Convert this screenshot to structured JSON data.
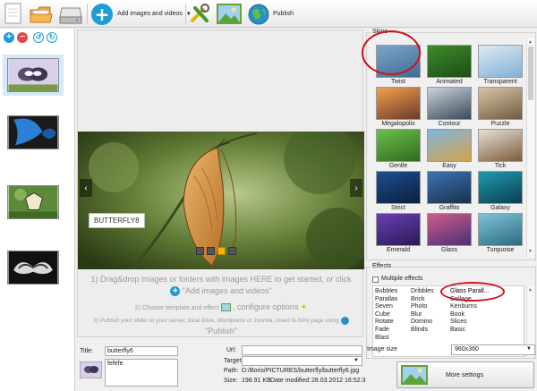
{
  "toolbar": {
    "add_label": "Add images and videos",
    "publish_label": "Publish"
  },
  "slide": {
    "caption": "BUTTERFLY8",
    "bullets": [
      false,
      false,
      true,
      false
    ]
  },
  "hints": {
    "line1": "1) Drag&drop images or folders with images HERE to get started, or click",
    "line1b": "\"Add images and videos\"",
    "line2a": "2) Choose template and effect",
    "line2b": ", configure options",
    "line3": "3) Publish your slider to your server, local drive, Wordpress or Joomla, insert to html page using",
    "line3b": "\"Publish\""
  },
  "props": {
    "title_label": "Title:",
    "title_value": "butterfly6",
    "desc_value": "fefefe",
    "url_label": "Url:",
    "url_value": "",
    "target_label": "Target",
    "path_label": "Path:",
    "path_value": "D:/Boris/PICTURES/butterfly/butterfly6.jpg",
    "size_label": "Size:",
    "size_value": "198.91 KB",
    "date_label": "Date modified:",
    "date_value": "28.03.2012 16:52:31"
  },
  "skins": {
    "title": "Skins",
    "items": [
      {
        "name": "Twist",
        "c1": "#7fa4c9",
        "c2": "#3f6c97"
      },
      {
        "name": "Animated",
        "c1": "#3e8a2c",
        "c2": "#1d4e17"
      },
      {
        "name": "Transparent",
        "c1": "#e0eaf3",
        "c2": "#7fb0d6"
      },
      {
        "name": "Megalopolis",
        "c1": "#f2a04a",
        "c2": "#6a3b2a"
      },
      {
        "name": "Contour",
        "c1": "#c9d4de",
        "c2": "#3a4a56"
      },
      {
        "name": "Puzzle",
        "c1": "#d9c5a5",
        "c2": "#6e5a40"
      },
      {
        "name": "Gentle",
        "c1": "#6cc04a",
        "c2": "#2f6a1c"
      },
      {
        "name": "Easy",
        "c1": "#7fb6e0",
        "c2": "#d5a24a"
      },
      {
        "name": "Tick",
        "c1": "#e8e0d5",
        "c2": "#7b5c3b"
      },
      {
        "name": "Strict",
        "c1": "#1e4f8f",
        "c2": "#0a1f3d"
      },
      {
        "name": "Graffito",
        "c1": "#3b75b5",
        "c2": "#1b2f4a"
      },
      {
        "name": "Galaxy",
        "c1": "#1f9bb0",
        "c2": "#0b3d50"
      },
      {
        "name": "Emerald",
        "c1": "#6a3fb5",
        "c2": "#2b1a55"
      },
      {
        "name": "Glass",
        "c1": "#d05c8a",
        "c2": "#4a2f75"
      },
      {
        "name": "Turquoise",
        "c1": "#7fc4d8",
        "c2": "#2d6a7f"
      }
    ]
  },
  "effects": {
    "title": "Effects",
    "multiple_label": "Multiple effects",
    "col1": [
      "Bubbles",
      "Parallax",
      "Seven",
      "Cube",
      "Rotate",
      "Fade",
      "Blast"
    ],
    "col2": [
      "Dribbles",
      "Brick",
      "Photo",
      "Blur",
      "Domino",
      "Blinds"
    ],
    "col3": [
      "Glass Parall...",
      "Collage",
      "Kenburns",
      "Book",
      "Slices",
      "Basic"
    ]
  },
  "image_size": {
    "label": "Image size",
    "value": "960x360"
  },
  "more_settings_label": "More settings",
  "colors": {
    "accent": "#1c9dd6",
    "highlight": "#d0101a",
    "bullet_active": "#f5b400"
  }
}
